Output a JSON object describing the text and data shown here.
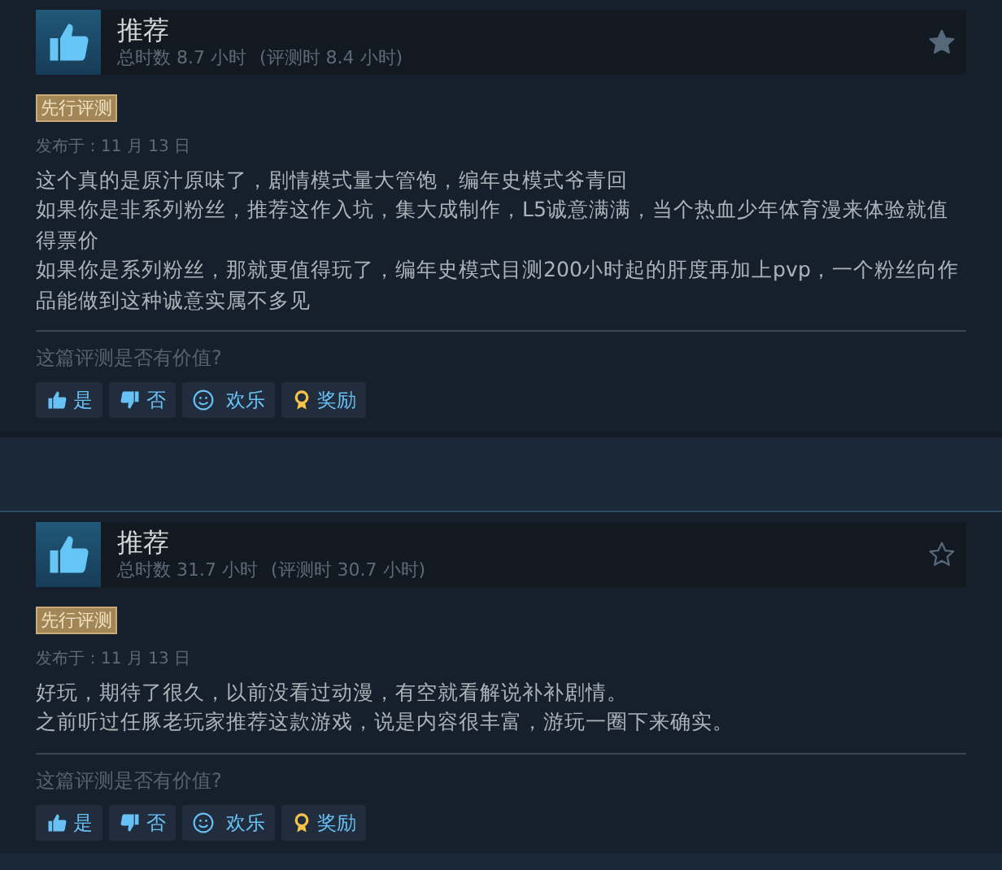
{
  "reviews": [
    {
      "verdict": "推荐",
      "recommended": true,
      "starred": true,
      "hours": "总时数 8.7 小时",
      "hours_at_review": "(评测时 8.4 小时)",
      "badge": "先行评测",
      "posted": "发布于：11 月 13 日",
      "body": [
        "这个真的是原汁原味了，剧情模式量大管饱，编年史模式爷青回",
        "如果你是非系列粉丝，推荐这作入坑，集大成制作，L5诚意满满，当个热血少年体育漫来体验就值得票价",
        "如果你是系列粉丝，那就更值得玩了，编年史模式目测200小时起的肝度再加上pvp，一个粉丝向作品能做到这种诚意实属不多见"
      ],
      "question": "这篇评测是否有价值?",
      "buttons": [
        {
          "kind": "yes",
          "label": "是"
        },
        {
          "kind": "no",
          "label": "否"
        },
        {
          "kind": "funny",
          "label": "欢乐"
        },
        {
          "kind": "award",
          "label": "奖励"
        }
      ]
    },
    {
      "verdict": "推荐",
      "recommended": true,
      "starred": false,
      "hours": "总时数 31.7 小时",
      "hours_at_review": "(评测时 30.7 小时)",
      "badge": "先行评测",
      "posted": "发布于：11 月 13 日",
      "body": [
        "好玩，期待了很久，以前没看过动漫，有空就看解说补补剧情。",
        "之前听过任豚老玩家推荐这款游戏，说是内容很丰富，游玩一圈下来确实。"
      ],
      "question": "这篇评测是否有价值?",
      "buttons": [
        {
          "kind": "yes",
          "label": "是"
        },
        {
          "kind": "no",
          "label": "否"
        },
        {
          "kind": "funny",
          "label": "欢乐"
        },
        {
          "kind": "award",
          "label": "奖励"
        }
      ]
    }
  ]
}
